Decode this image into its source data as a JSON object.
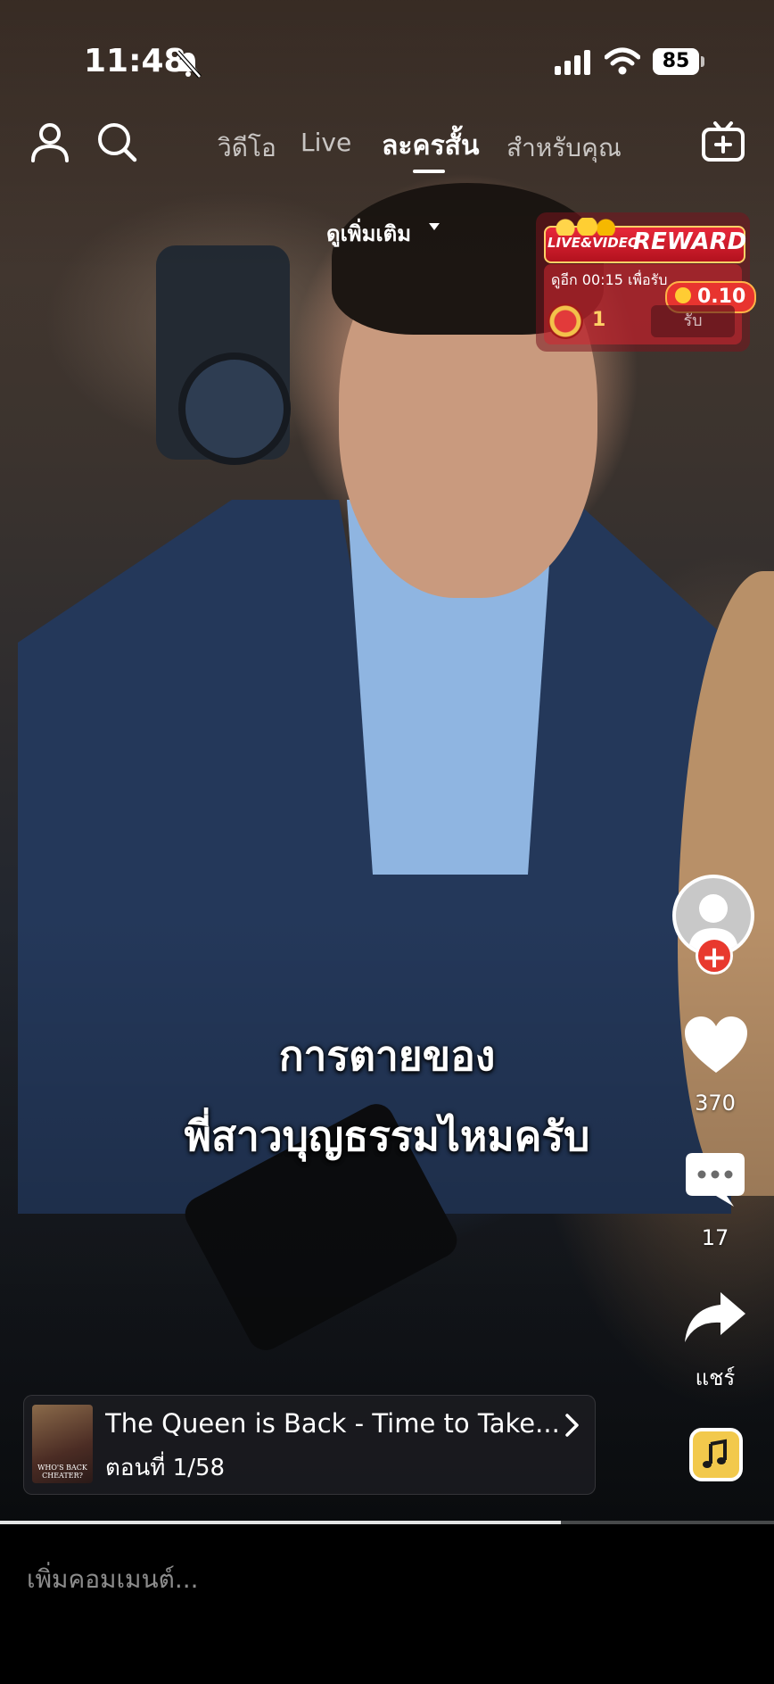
{
  "status_bar": {
    "time": "11:48",
    "battery": "85"
  },
  "nav": {
    "tabs": [
      {
        "label": "วิดีโอ"
      },
      {
        "label": "Live"
      },
      {
        "label": "ละครสั้น"
      },
      {
        "label": "สำหรับคุณ"
      }
    ],
    "active_tab": "ละครสั้น"
  },
  "see_more": "ดูเพิ่มเติม",
  "reward": {
    "brand_prefix": "LIVE&VIDEO",
    "title": "REWARD",
    "timer_text": "ดูอีก 00:15 เพื่อรับ",
    "amount": "0.10",
    "chest_count": "1",
    "claim_label": "รับ"
  },
  "caption": {
    "line1": "การตายของ",
    "line2": "พี่สาวบุญธรรมไหมครับ"
  },
  "actions": {
    "likes": "370",
    "comments": "17",
    "share_label": "แชร์"
  },
  "series": {
    "title": "The Queen is Back - Time to Take...",
    "episode": "ตอนที่ 1/58",
    "thumb_text": "WHO'S BACK CHEATER?"
  },
  "playback": {
    "progress": 0.725
  },
  "comment": {
    "placeholder": "เพิ่มคอมเมนต์..."
  },
  "colors": {
    "follow": "#e8392e",
    "reward_red": "#e8283a",
    "music_yellow": "#f2c94c"
  },
  "icons": [
    "profile-icon",
    "search-icon",
    "create-video-icon",
    "bell-off-icon",
    "signal-icon",
    "wifi-icon",
    "heart-icon",
    "comment-icon",
    "share-icon",
    "music-icon",
    "chevron-right-icon"
  ]
}
